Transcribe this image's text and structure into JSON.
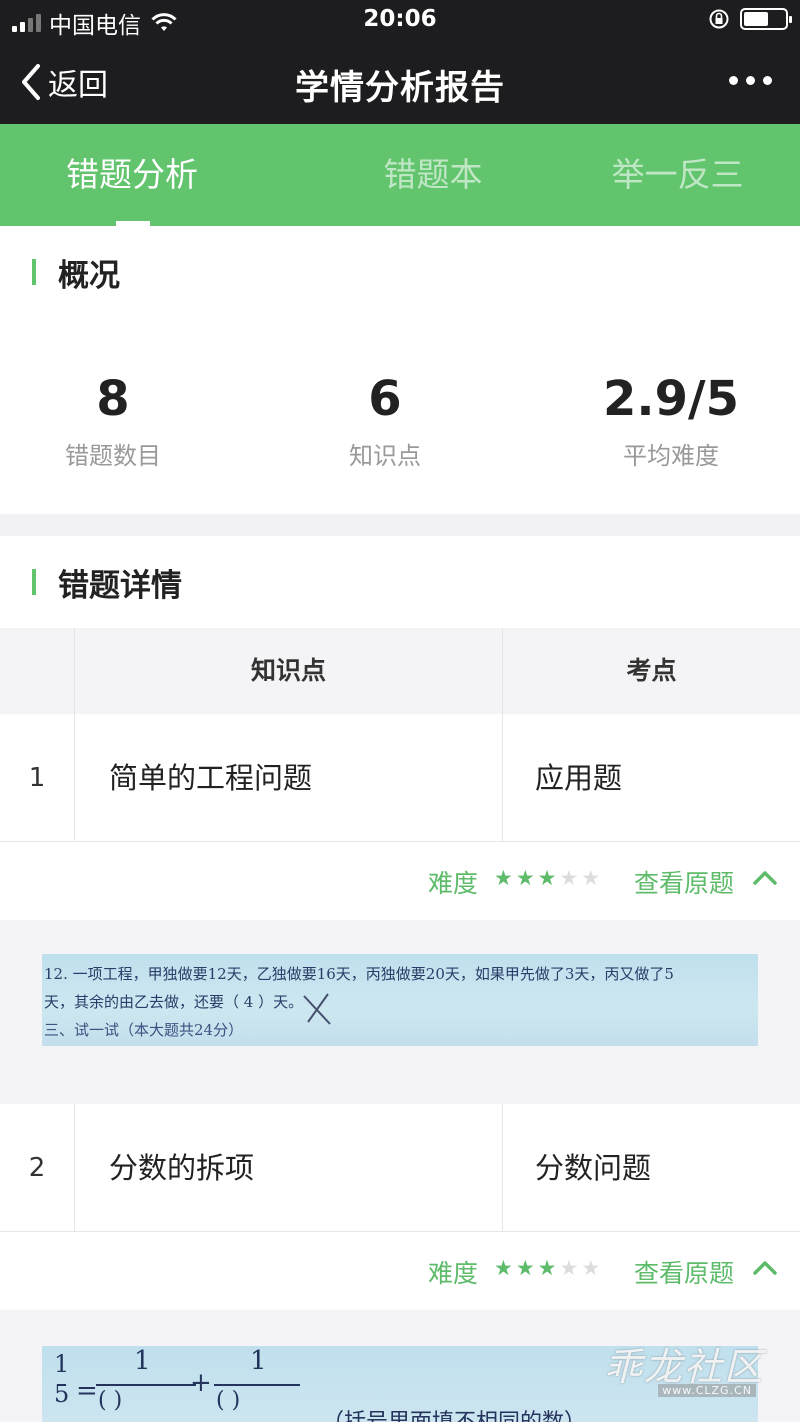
{
  "status_bar": {
    "carrier": "中国电信",
    "time": "20:06"
  },
  "nav": {
    "back_label": "返回",
    "title": "学情分析报告"
  },
  "tabs": [
    {
      "label": "错题分析",
      "active": true
    },
    {
      "label": "错题本",
      "active": false
    },
    {
      "label": "举一反三",
      "active": false
    }
  ],
  "overview": {
    "title": "概况",
    "stats": [
      {
        "value": "8",
        "label": "错题数目"
      },
      {
        "value": "6",
        "label": "知识点"
      },
      {
        "value": "2.9/5",
        "label": "平均难度"
      }
    ]
  },
  "details": {
    "title": "错题详情",
    "columns": [
      "知识点",
      "考点"
    ],
    "rows": [
      {
        "index": "1",
        "knowledge_point": "简单的工程问题",
        "topic": "应用题",
        "difficulty_label": "难度",
        "difficulty_stars": 3,
        "difficulty_max": 5,
        "view_label": "查看原题",
        "question_text": [
          "12. 一项工程，甲独做要12天，乙独做要16天，丙独做要20天，如果甲先做了3天，丙又做了5",
          "天，其余的由乙去做，还要（ 4 ）天。",
          "三、试一试（本大题共24分）"
        ]
      },
      {
        "index": "2",
        "knowledge_point": "分数的拆项",
        "topic": "分数问题",
        "difficulty_label": "难度",
        "difficulty_stars": 3,
        "difficulty_max": 5,
        "view_label": "查看原题",
        "question_text": [
          "1",
          "5",
          "=",
          "1",
          "(    )",
          "+",
          "1",
          "(    )",
          "（括号里面填不相同的数）"
        ]
      }
    ]
  },
  "watermark": {
    "brand": "乖龙社区",
    "url": "www.CLZG.CN"
  },
  "colors": {
    "accent": "#63c46e",
    "nav_bg": "#1d1d1f",
    "link": "#5dbb6a"
  }
}
